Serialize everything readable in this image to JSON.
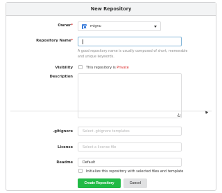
{
  "header": {
    "title": "New Repository"
  },
  "owner": {
    "label": "Owner",
    "value": "mignu",
    "avatar_color": "#3d7edb"
  },
  "repo_name": {
    "label": "Repository Name",
    "value": "",
    "help": "A good repository name is usually composed of short, memorable and unique keywords."
  },
  "visibility": {
    "label": "Visibility",
    "checkbox_text": "This repository is ",
    "private_text": "Private",
    "checked": false
  },
  "description": {
    "label": "Description",
    "value": ""
  },
  "gitignore": {
    "label": ".gitignore",
    "placeholder": "Select .gitignore templates"
  },
  "license": {
    "label": "License",
    "placeholder": "Select a license file"
  },
  "readme": {
    "label": "Readme",
    "value": "Default"
  },
  "init": {
    "label": "Initialize this repository with selected files and template",
    "checked": false
  },
  "buttons": {
    "create": "Create Repository",
    "cancel": "Cancel"
  },
  "colors": {
    "primary": "#21ba45",
    "required": "#db2828",
    "focus_border": "#85b7d9"
  },
  "required_mark": "*"
}
